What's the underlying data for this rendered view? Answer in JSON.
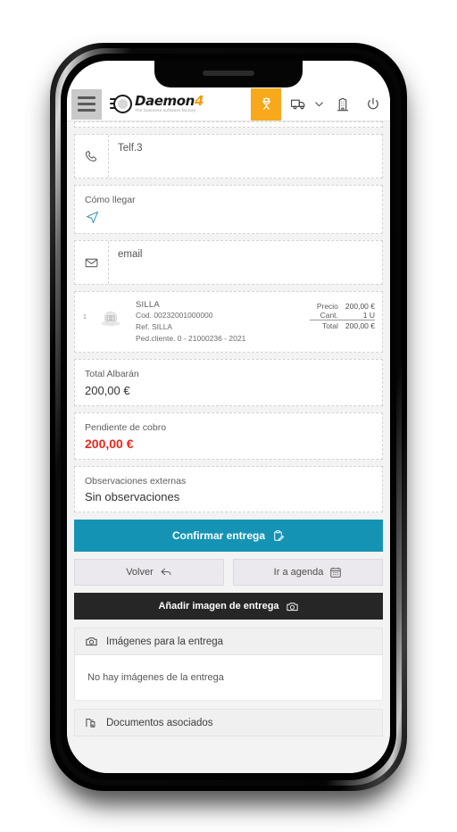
{
  "app": {
    "brand_name": "Daemon",
    "brand_accent": "4",
    "brand_tagline": "The business software factory",
    "accent_orange": "#f7a81b",
    "accent_teal": "#1593b4",
    "alert_red": "#e8281b"
  },
  "header": {
    "menu_label": "menu",
    "icons": [
      {
        "name": "worker-icon",
        "label": "Operarios",
        "active": true
      },
      {
        "name": "truck-icon",
        "label": "Entregas",
        "active": false
      },
      {
        "name": "chevron-down-icon",
        "label": "Desplegar",
        "active": false
      },
      {
        "name": "building-icon",
        "label": "Empresa",
        "active": false
      },
      {
        "name": "power-icon",
        "label": "Salir",
        "active": false
      }
    ]
  },
  "fields": {
    "phone": {
      "label": "Telf.3",
      "value": ""
    },
    "directions": {
      "label": "Cómo llegar",
      "icon": "navigation-icon"
    },
    "email": {
      "label": "email",
      "value": ""
    }
  },
  "line_item": {
    "index": "1",
    "name": "SILLA",
    "code": "Cod. 00232001000000",
    "ref": "Ref. SILLA",
    "order": "Ped.cliente. 0 - 21000236 - 2021",
    "amounts": [
      {
        "key": "Precio",
        "value": "200,00 €"
      },
      {
        "key": "Cant.",
        "value": "1 U"
      },
      {
        "key": "Total",
        "value": "200,00 €"
      }
    ]
  },
  "totals": {
    "albaran_label": "Total Albarán",
    "albaran_value": "200,00 €",
    "pending_label": "Pendiente de cobro",
    "pending_value": "200,00 €"
  },
  "observations": {
    "label": "Observaciones externas",
    "value": "Sin observaciones"
  },
  "actions": {
    "confirm": "Confirmar entrega",
    "back": "Volver",
    "agenda": "Ir a agenda",
    "add_image": "Añadir imagen de entrega"
  },
  "images_section": {
    "title": "Imágenes para la entrega",
    "empty": "No hay imágenes de la entrega"
  },
  "documents_section": {
    "title": "Documentos asociados"
  }
}
